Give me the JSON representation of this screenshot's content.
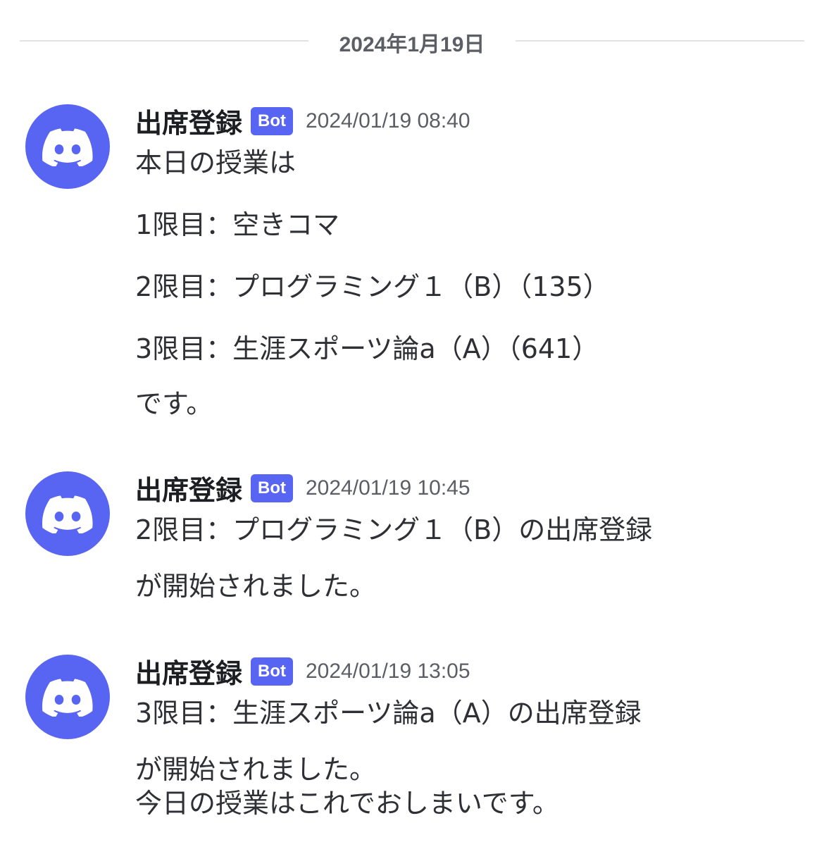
{
  "date_divider": "2024年1月19日",
  "colors": {
    "accent": "#5865f2",
    "text": "#2e3035",
    "muted": "#5c5e66"
  },
  "messages": [
    {
      "avatar_icon": "discord-logo-icon",
      "username": "出席登録",
      "tag": "Bot",
      "timestamp": "2024/01/19 08:40",
      "lines": [
        "本日の授業は",
        "1限目：空きコマ",
        "2限目：プログラミング１（B）（135）",
        "3限目：生涯スポーツ論a（A）（641）",
        "です。"
      ]
    },
    {
      "avatar_icon": "discord-logo-icon",
      "username": "出席登録",
      "tag": "Bot",
      "timestamp": "2024/01/19 10:45",
      "lines": [
        "2限目：プログラミング１（B）の出席登録",
        "が開始されました。"
      ]
    },
    {
      "avatar_icon": "discord-logo-icon",
      "username": "出席登録",
      "tag": "Bot",
      "timestamp": "2024/01/19 13:05",
      "lines": [
        "3限目：生涯スポーツ論a（A）の出席登録",
        "が開始されました。",
        "今日の授業はこれでおしまいです。"
      ]
    }
  ]
}
